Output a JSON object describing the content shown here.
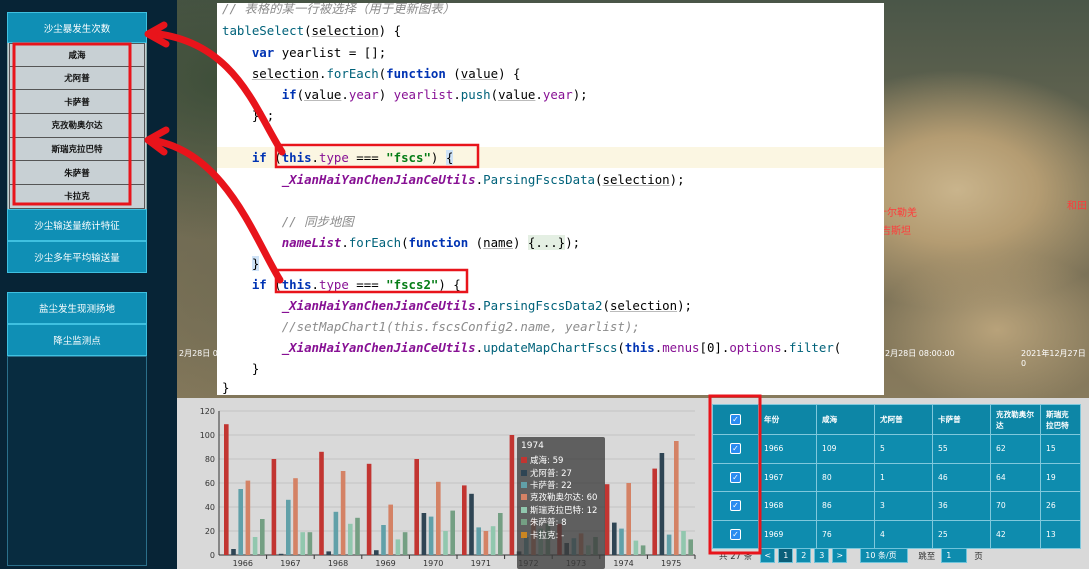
{
  "sidebar": {
    "primary_menu": "沙尘暴发生次数",
    "sub_items": [
      "咸海",
      "尤阿普",
      "卡萨普",
      "克孜勒奥尔达",
      "斯瑞克拉巴特",
      "朱萨普",
      "卡拉克"
    ],
    "menu2": "沙尘输送量统计特征",
    "menu3": "沙尘多年平均输送量",
    "menu4": "盐尘发生现测扬地",
    "menu5": "降尘监测点"
  },
  "map": {
    "time_left": "2月28日 08:00",
    "time_mid": "2月28日 08:00:00",
    "time_right": "2021年12月27日 0",
    "label1": "叶尔勒羌",
    "label2": "吉斯坦",
    "label3": "和田"
  },
  "code": {
    "l1_comment": "// 表格的某一行被选择（用于更新图表）",
    "l2_name": "tableSelect",
    "l2_param": "selection",
    "l3_kw": "var",
    "l3_var": "yearlist",
    "l4_obj": "selection",
    "l4_method": "forEach",
    "l4_kw": "function",
    "l4_param": "value",
    "l5_kw": "if",
    "l5_obj": "value",
    "l5_field": "year",
    "l5_var": "yearlist",
    "l5_method": "push",
    "l7_kw": "if",
    "l7_this": "this",
    "l7_field": "type",
    "l7_str": "\"fscs\"",
    "l8_class": "_XianHaiYanChenJianCeUtils",
    "l8_method": "ParsingFscsData",
    "l8_param": "selection",
    "l10_comment": "// 同步地图",
    "l11_field": "nameList",
    "l11_method": "forEach",
    "l11_kw": "function",
    "l11_param": "name",
    "l11_fold": "{...}",
    "l13_kw": "if",
    "l13_this": "this",
    "l13_field": "type",
    "l13_str": "\"fscs2\"",
    "l14_class": "_XianHaiYanChenJianCeUtils",
    "l14_method": "ParsingFscsData2",
    "l14_param": "selection",
    "l15_comment": "//setMapChart1(this.fscsConfig2.name, yearlist);",
    "l16_class": "_XianHaiYanChenJianCeUtils",
    "l16_method": "updateMapChartFscs",
    "l16_this": "this",
    "l16_menus": "menus",
    "l16_options": "options",
    "l16_filter": "filter"
  },
  "chart_data": {
    "type": "bar",
    "categories": [
      "1966",
      "1967",
      "1968",
      "1969",
      "1970",
      "1971",
      "1972",
      "1973",
      "1974",
      "1975"
    ],
    "ylim": [
      0,
      120
    ],
    "yticks": [
      0,
      20,
      40,
      60,
      80,
      100,
      120
    ],
    "series": [
      {
        "name": "咸海",
        "color": "#c23531",
        "values": [
          109,
          80,
          86,
          76,
          80,
          58,
          100,
          26,
          59,
          72
        ]
      },
      {
        "name": "尤阿普",
        "color": "#2f4554",
        "values": [
          5,
          1,
          3,
          4,
          35,
          51,
          3,
          10,
          27,
          85
        ]
      },
      {
        "name": "卡萨普",
        "color": "#61a0a8",
        "values": [
          55,
          46,
          36,
          25,
          32,
          23,
          15,
          14,
          22,
          17
        ]
      },
      {
        "name": "克孜勒奥尔达",
        "color": "#d48265",
        "values": [
          62,
          64,
          70,
          42,
          61,
          20,
          30,
          18,
          60,
          95
        ]
      },
      {
        "name": "斯瑞克拉巴特",
        "color": "#91c7ae",
        "values": [
          15,
          19,
          26,
          13,
          20,
          24,
          22,
          8,
          12,
          20
        ]
      },
      {
        "name": "朱萨普",
        "color": "#749f83",
        "values": [
          30,
          19,
          31,
          19,
          37,
          35,
          26,
          15,
          8,
          13
        ]
      }
    ]
  },
  "tooltip": {
    "title": "1974",
    "rows": [
      {
        "label": "咸海: 59",
        "color": "#c23531"
      },
      {
        "label": "尤阿普: 27",
        "color": "#2f4554"
      },
      {
        "label": "卡萨普: 22",
        "color": "#61a0a8"
      },
      {
        "label": "克孜勒奥尔达: 60",
        "color": "#d48265"
      },
      {
        "label": "斯瑞克拉巴特: 12",
        "color": "#91c7ae"
      },
      {
        "label": "朱萨普: 8",
        "color": "#749f83"
      },
      {
        "label": "卡拉克: -",
        "color": "#ca8622"
      }
    ]
  },
  "table": {
    "headers": [
      "年份",
      "咸海",
      "尤阿普",
      "卡萨普",
      "克孜勒奥尔达",
      "斯瑞克拉巴特"
    ],
    "rows": [
      [
        "1966",
        "109",
        "5",
        "55",
        "62",
        "15"
      ],
      [
        "1967",
        "80",
        "1",
        "46",
        "64",
        "19"
      ],
      [
        "1968",
        "86",
        "3",
        "36",
        "70",
        "26"
      ],
      [
        "1969",
        "76",
        "4",
        "25",
        "42",
        "13"
      ]
    ],
    "check_mark": "✓"
  },
  "pager": {
    "total": "共 27 条",
    "prev": "<",
    "pages": [
      "1",
      "2",
      "3"
    ],
    "next": ">",
    "page_size": "10 条/页",
    "jump_label": "跳至",
    "jump_value": "1",
    "page_suffix": "页"
  },
  "colors": {
    "annotation_red": "#e8141b",
    "menu_blue": "#0f8fb5"
  }
}
